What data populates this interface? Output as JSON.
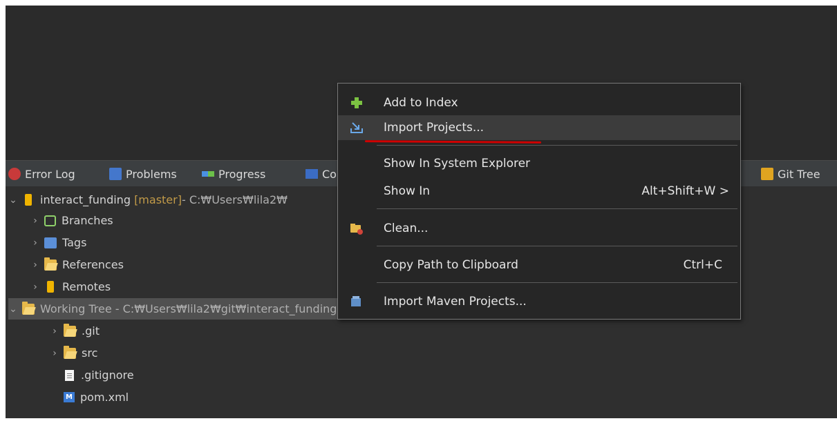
{
  "tabs": [
    {
      "label": "Error Log",
      "icon": "error-log-icon"
    },
    {
      "label": "Problems",
      "icon": "problems-icon"
    },
    {
      "label": "Progress",
      "icon": "progress-icon"
    },
    {
      "label": "Co",
      "icon": "console-icon"
    },
    {
      "label": "Git Tree",
      "icon": "git-tree-icon"
    }
  ],
  "tree": {
    "repo": {
      "name": "interact_funding",
      "branch": "[master]",
      "path": " - C:₩Users₩lila2₩"
    },
    "nodes": [
      "Branches",
      "Tags",
      "References",
      "Remotes"
    ],
    "working_tree": "Working Tree - C:₩Users₩lila2₩git₩interact_funding",
    "children": [
      ".git",
      "src",
      ".gitignore",
      "pom.xml"
    ]
  },
  "context_menu": {
    "items": [
      {
        "label": "Add to Index",
        "accel": "",
        "icon": "plus-icon"
      },
      {
        "label": "Import Projects...",
        "accel": "",
        "icon": "import-projects-icon"
      },
      {
        "label": "Show In System Explorer",
        "accel": "",
        "icon": ""
      },
      {
        "label": "Show In",
        "accel": "Alt+Shift+W >",
        "icon": ""
      },
      {
        "label": "Clean...",
        "accel": "",
        "icon": "clean-icon"
      },
      {
        "label": "Copy Path to Clipboard",
        "accel": "Ctrl+C",
        "icon": ""
      },
      {
        "label": "Import Maven Projects...",
        "accel": "",
        "icon": "maven-import-icon"
      }
    ]
  },
  "colors": {
    "annotation_underline": "#d00000",
    "repo_icon": "#f0b400",
    "plus": "#7cc242"
  }
}
